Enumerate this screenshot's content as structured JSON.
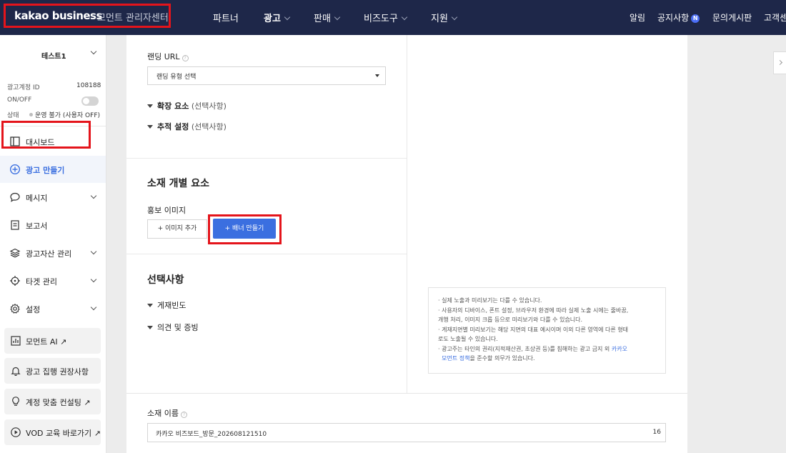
{
  "header": {
    "brand": "kakao business",
    "brand_sub": "모먼트 관리자센터",
    "nav": [
      {
        "label": "파트너"
      },
      {
        "label": "광고"
      },
      {
        "label": "판매"
      },
      {
        "label": "비즈도구"
      },
      {
        "label": "지원"
      }
    ],
    "right": {
      "alarm": "알림",
      "notice": "공지사항",
      "notice_badge": "N",
      "board": "문의게시판",
      "customer": "고객센"
    },
    "colors": {
      "background": "#1e2749",
      "highlight_box": "#e4141b"
    }
  },
  "sidebar": {
    "account_name": "테스트1",
    "account_id_label": "광고계정 ID",
    "account_id": "108188",
    "onoff_label": "ON/OFF",
    "status_label": "상태",
    "status_value": "운영 불가 (사용자 OFF)",
    "toggle_on": false,
    "items": [
      {
        "label": "대시보드",
        "icon": "dashboard-icon"
      },
      {
        "label": "광고 만들기",
        "icon": "plus-circle-icon"
      },
      {
        "label": "메시지",
        "icon": "speech-bubble-icon"
      },
      {
        "label": "보고서",
        "icon": "report-icon"
      },
      {
        "label": "광고자산 관리",
        "icon": "layers-icon"
      },
      {
        "label": "타겟 관리",
        "icon": "target-icon"
      },
      {
        "label": "설정",
        "icon": "gear-icon"
      }
    ],
    "cards": [
      {
        "label": "모먼트 AI",
        "icon": "chart-icon"
      },
      {
        "label": "광고 집행 권장사항",
        "icon": "bell-icon"
      },
      {
        "label": "계정 맞춤 컨설팅",
        "icon": "lightbulb-icon"
      },
      {
        "label": "VOD 교육 바로가기",
        "icon": "play-circle-icon"
      }
    ]
  },
  "form": {
    "landing_label": "랜딩 URL",
    "landing_select": "랜딩 유형 선택",
    "expanders_top": [
      {
        "title": "확장 요소",
        "sub": "(선택사항)"
      },
      {
        "title": "추적 설정",
        "sub": "(선택사항)"
      }
    ],
    "creative_title": "소재 개별 요소",
    "promo_image_label": "홍보 이미지",
    "add_image_button": "+ 이미지 추가",
    "banner_button": "+ 배너 만들기",
    "optional_title": "선택사항",
    "expanders_bottom": [
      {
        "title": "게재빈도"
      },
      {
        "title": "의견 및 증빙"
      }
    ],
    "creative_name_label": "소재 이름",
    "creative_name_value": "카카오 비즈보드_방문_202608121510",
    "creative_name_count": "16"
  },
  "notice": {
    "lines": [
      "· 실제 노출과 미리보기는 다를 수 있습니다.",
      "· 사용자의 디바이스, 폰트 설정, 브라우저 환경에 따라 실제 노출 시에는 줄바꿈,",
      "  개행 처리, 이미지 크롭 등으로 미리보기와 다를 수 있습니다.",
      "· 게재지면별 미리보기는 해당 지면의 대표 예시이며 이외 다른 영역에 다른 형태",
      "  로도 노출될 수 있습니다.",
      "· 광고주는 타인의 권리(지적재산권, 초상권 등)를 침해하는 광고 금지 외"
    ],
    "link_text_1": "카카오",
    "link_text_2": "모먼트 정책",
    "last_line_rest": "을 준수할 의무가 있습니다."
  }
}
